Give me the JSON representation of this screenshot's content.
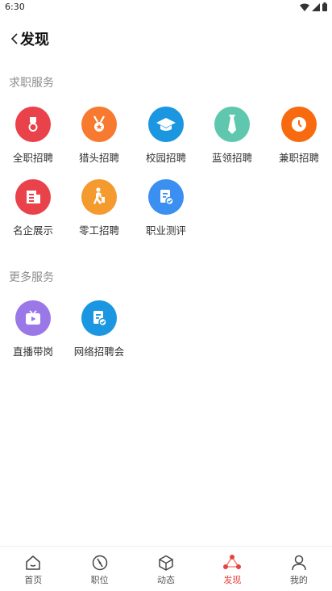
{
  "status_bar": {
    "time": "6:30"
  },
  "header": {
    "title": "发现"
  },
  "sections": [
    {
      "title": "求职服务",
      "items": [
        {
          "label": "全职招聘",
          "icon": "badge-icon",
          "color": "#e9424a"
        },
        {
          "label": "猎头招聘",
          "icon": "medal-icon",
          "color": "#f77a30"
        },
        {
          "label": "校园招聘",
          "icon": "graduation-cap-icon",
          "color": "#1b96e0"
        },
        {
          "label": "蓝领招聘",
          "icon": "tie-icon",
          "color": "#5fc7ae"
        },
        {
          "label": "兼职招聘",
          "icon": "clock-icon",
          "color": "#f86a10"
        },
        {
          "label": "名企展示",
          "icon": "building-icon",
          "color": "#e9424a"
        },
        {
          "label": "零工招聘",
          "icon": "worker-icon",
          "color": "#f59a2f"
        },
        {
          "label": "职业测评",
          "icon": "assessment-icon",
          "color": "#3a8ff0"
        }
      ]
    },
    {
      "title": "更多服务",
      "items": [
        {
          "label": "直播带岗",
          "icon": "tv-play-icon",
          "color": "#9a78e8"
        },
        {
          "label": "网络招聘会",
          "icon": "document-icon",
          "color": "#1b96e0"
        }
      ]
    }
  ],
  "tabs": [
    {
      "label": "首页",
      "icon": "home-icon",
      "active": false
    },
    {
      "label": "职位",
      "icon": "compass-icon",
      "active": false
    },
    {
      "label": "动态",
      "icon": "cube-icon",
      "active": false
    },
    {
      "label": "发现",
      "icon": "discover-icon",
      "active": true
    },
    {
      "label": "我的",
      "icon": "person-icon",
      "active": false
    }
  ],
  "colors": {
    "accent": "#e5443e",
    "section_title": "#8e8e8e",
    "tab_inactive": "#555555"
  }
}
